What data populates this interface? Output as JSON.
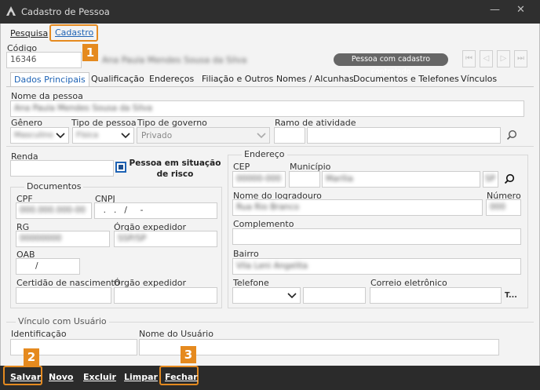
{
  "window": {
    "title": "Cadastro de Pessoa",
    "minimize_glyph": "—",
    "close_glyph": "✕"
  },
  "menu": {
    "items": [
      "Pesquisa",
      "Cadastro"
    ]
  },
  "codigo": {
    "label": "Código",
    "value": "16346",
    "blurred_name": "Ana Paula Mendes Sousa da Silva"
  },
  "status_pill": "Pessoa com cadastro controlado",
  "nav_buttons": [
    "⏮",
    "◁",
    "▷",
    "⏭"
  ],
  "tabs": [
    "Dados Principais",
    "Qualificação",
    "Endereços",
    "Filiação e Outros Nomes / Alcunhas",
    "Documentos e Telefones",
    "Vínculos"
  ],
  "fields": {
    "nome_label": "Nome da pessoa",
    "nome_value": "Ana Paula Mendes Sousa da Silva",
    "genero_label": "Gênero",
    "genero_value": "Masculino",
    "tipo_pessoa_label": "Tipo de pessoa",
    "tipo_pessoa_value": "Física",
    "tipo_governo_label": "Tipo de governo",
    "tipo_governo_value": "Privado",
    "ramo_label": "Ramo de atividade",
    "renda_label": "Renda",
    "risco_label": "Pessoa em situação de risco"
  },
  "documentos": {
    "title": "Documentos",
    "cpf_label": "CPF",
    "cpf_value": "000.000.000-00",
    "cnpj_label": "CNPJ",
    "cnpj_value": "  .   .   /     -",
    "rg_label": "RG",
    "rg_value": "00000000",
    "orgao1_label": "Órgão expedidor",
    "orgao1_value": "SSP/SP",
    "oab_label": "OAB",
    "oab_value": "/",
    "certidao_label": "Certidão de nascimento",
    "orgao2_label": "Órgão expedidor"
  },
  "endereco": {
    "title": "Endereço",
    "cep_label": "CEP",
    "cep_value": "00000-000",
    "municipio_label": "Município",
    "municipio_value": "Marília",
    "uf_value": "SP",
    "logradouro_label": "Nome do logradouro",
    "logradouro_value": "Rua Rio Branco",
    "numero_label": "Número",
    "numero_value": "000",
    "complemento_label": "Complemento",
    "bairro_label": "Bairro",
    "bairro_value": "Vila Leni Angelita",
    "telefone_label": "Telefone",
    "email_label": "Correio eletrônico",
    "email_extra": "T..."
  },
  "vinculo": {
    "title": "Vínculo com Usuário",
    "identificacao_label": "Identificação",
    "usuario_label": "Nome do Usuário"
  },
  "footer": {
    "buttons": [
      "Salvar",
      "Novo",
      "Excluir",
      "Limpar",
      "Fechar"
    ]
  },
  "annotations": [
    "1",
    "2",
    "3"
  ],
  "colors": {
    "accent": "#1e63b5",
    "highlight": "#e58a1f",
    "titlebar": "#2f2f2f",
    "footer": "#2b2b2b"
  }
}
